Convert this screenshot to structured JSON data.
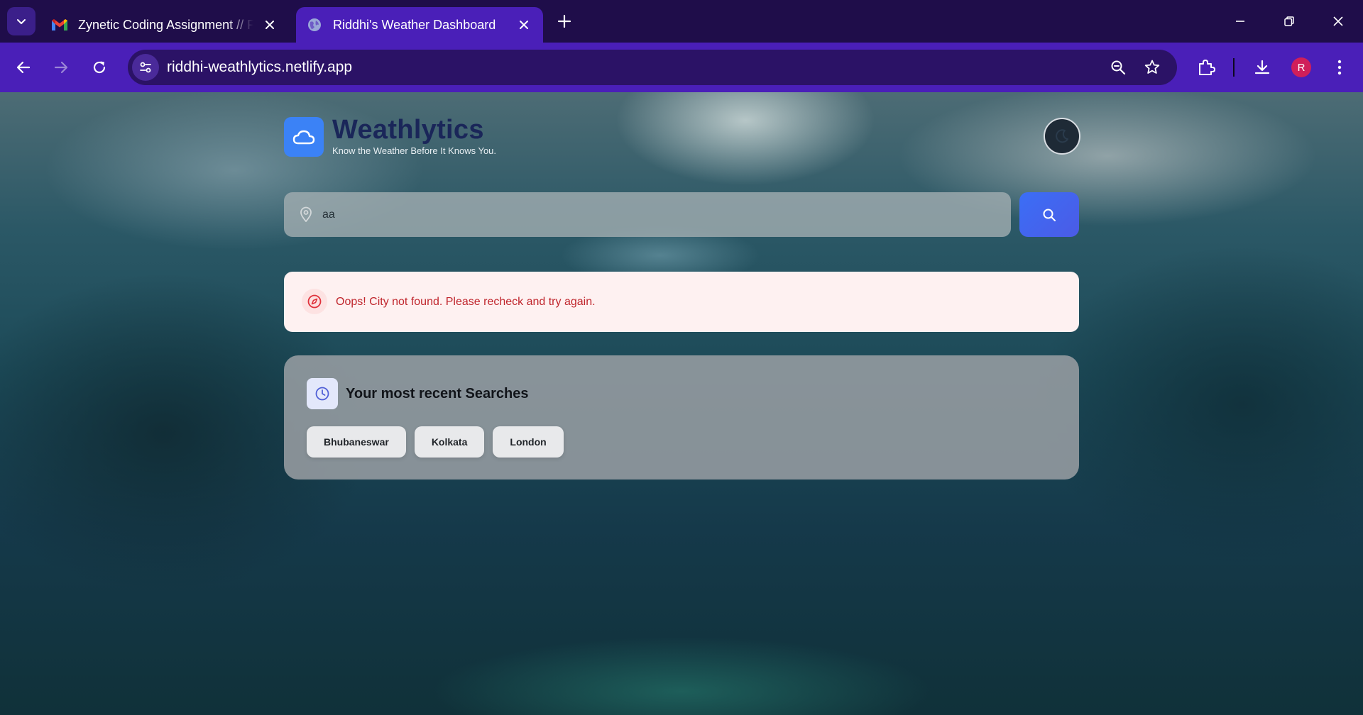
{
  "browser": {
    "tabs": [
      {
        "title": "Zynetic Coding Assignment // F",
        "favicon": "gmail-icon",
        "active": false
      },
      {
        "title": "Riddhi's Weather Dashboard",
        "favicon": "globe-icon",
        "active": true
      }
    ],
    "url": "riddhi-weathlytics.netlify.app",
    "profile_initial": "R",
    "colors": {
      "tabstrip": "#1f0d4a",
      "toolbar": "#4a1fb8",
      "avatar": "#d01f5a"
    }
  },
  "app": {
    "brand": "Weathlytics",
    "tagline": "Know the Weather Before It Knows You.",
    "logo_icon": "cloud-icon",
    "theme_toggle_icon": "moon-icon",
    "search": {
      "value": "aa",
      "icon": "map-pin-icon",
      "button_icon": "search-icon"
    },
    "error": {
      "message": "Oops! City not found. Please recheck and try again.",
      "icon": "compass-icon",
      "color": "#c0262d"
    },
    "recent": {
      "title": "Your most recent Searches",
      "icon": "clock-icon",
      "items": [
        "Bhubaneswar",
        "Kolkata",
        "London"
      ]
    },
    "colors": {
      "accent": "#3b82f6",
      "brand_text": "#1a2659",
      "error_bg": "#fef1f1"
    }
  }
}
